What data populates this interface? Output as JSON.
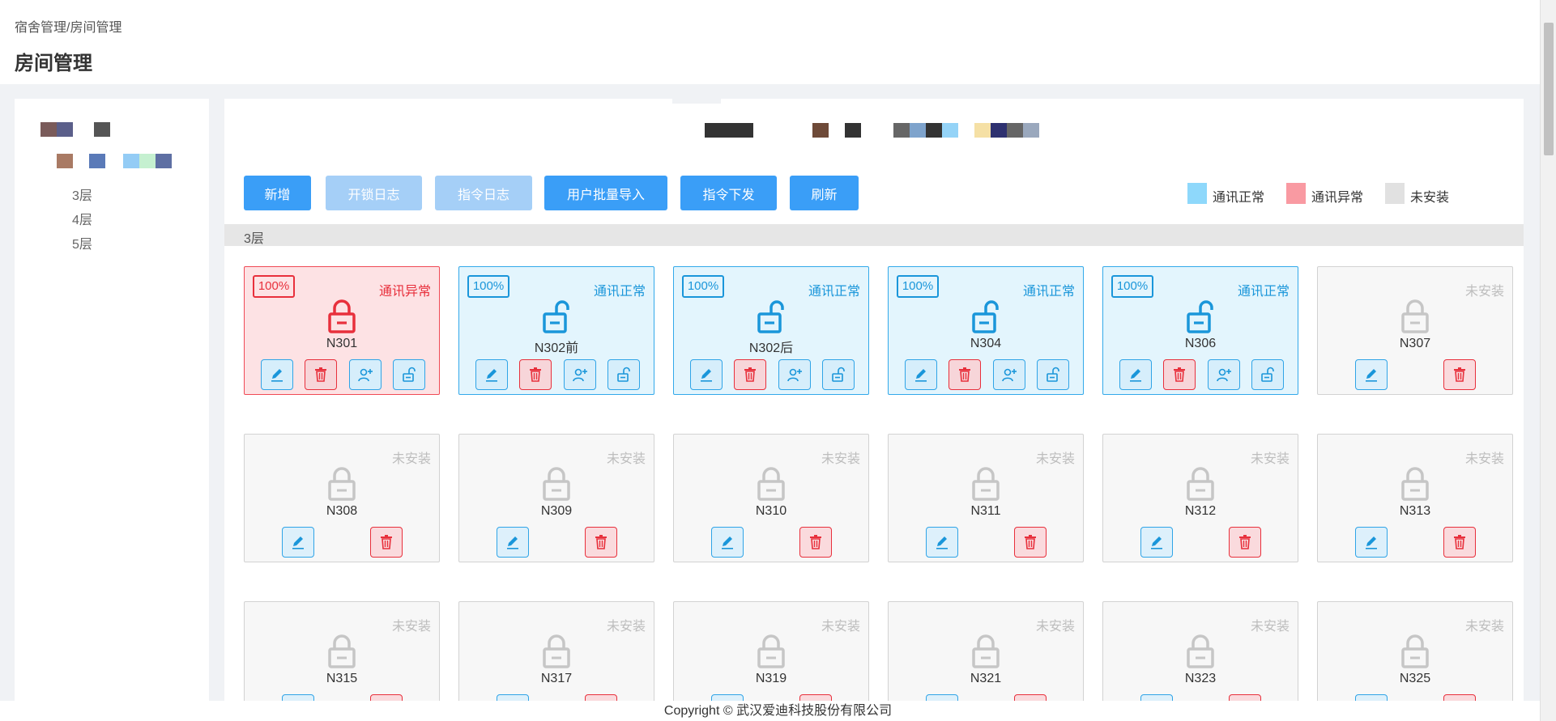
{
  "header": {
    "breadcrumb": "宿舍管理/房间管理",
    "title": "房间管理"
  },
  "sidebar": {
    "floors": [
      "3层",
      "4层",
      "5层"
    ]
  },
  "toolbar": {
    "add_label": "新增",
    "unlock_log_label": "开锁日志",
    "command_log_label": "指令日志",
    "batch_import_label": "用户批量导入",
    "command_send_label": "指令下发",
    "refresh_label": "刷新"
  },
  "legend": {
    "ok_label": "通讯正常",
    "error_label": "通讯异常",
    "none_label": "未安装",
    "ok_color": "#8ed8fb",
    "error_color": "#f99aa2",
    "none_color": "#e1e1e1"
  },
  "floor_header": "3层",
  "status_labels": {
    "error": "通讯异常",
    "ok": "通讯正常",
    "none": "未安装"
  },
  "rooms": [
    {
      "name": "N301",
      "status": "error",
      "battery": "100%"
    },
    {
      "name": "N302前",
      "status": "ok",
      "battery": "100%"
    },
    {
      "name": "N302后",
      "status": "ok",
      "battery": "100%"
    },
    {
      "name": "N304",
      "status": "ok",
      "battery": "100%"
    },
    {
      "name": "N306",
      "status": "ok",
      "battery": "100%"
    },
    {
      "name": "N307",
      "status": "none"
    },
    {
      "name": "N308",
      "status": "none"
    },
    {
      "name": "N309",
      "status": "none"
    },
    {
      "name": "N310",
      "status": "none"
    },
    {
      "name": "N311",
      "status": "none"
    },
    {
      "name": "N312",
      "status": "none"
    },
    {
      "name": "N313",
      "status": "none"
    },
    {
      "name": "N315",
      "status": "none"
    },
    {
      "name": "N317",
      "status": "none"
    },
    {
      "name": "N319",
      "status": "none"
    },
    {
      "name": "N321",
      "status": "none"
    },
    {
      "name": "N323",
      "status": "none"
    },
    {
      "name": "N325",
      "status": "none"
    }
  ],
  "footer": {
    "copyright": "Copyright © 武汉爱迪科技股份有限公司"
  }
}
